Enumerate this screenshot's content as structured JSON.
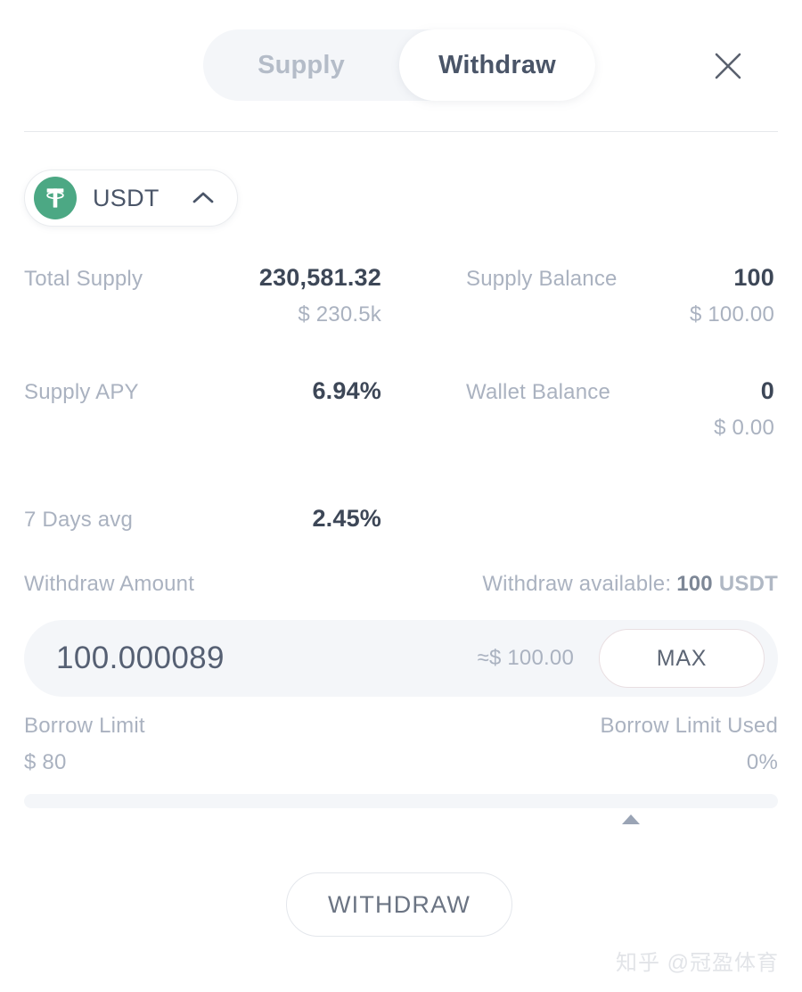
{
  "header": {
    "tabs": [
      {
        "label": "Supply",
        "active": false
      },
      {
        "label": "Withdraw",
        "active": true
      }
    ],
    "close_icon": "close-icon"
  },
  "token_selector": {
    "symbol": "USDT",
    "logo_icon": "tether-logo-icon",
    "logo_color": "#4CA884",
    "chevron_icon": "chevron-up-icon"
  },
  "stats": {
    "total_supply": {
      "label": "Total Supply",
      "value": "230,581.32",
      "sub": "$ 230.5k"
    },
    "supply_balance": {
      "label": "Supply Balance",
      "value": "100",
      "sub": "$ 100.00"
    },
    "supply_apy": {
      "label": "Supply APY",
      "value": "6.94%"
    },
    "wallet_balance": {
      "label": "Wallet Balance",
      "value": "0",
      "sub": "$ 0.00"
    },
    "seven_days_avg": {
      "label": "7 Days avg",
      "value": "2.45%"
    }
  },
  "amount": {
    "label": "Withdraw Amount",
    "available_prefix": "Withdraw available:",
    "available_amount": "100",
    "available_symbol": "USDT",
    "input_value": "100.000089",
    "input_placeholder": "0",
    "approx": "≈$ 100.00",
    "max_label": "MAX"
  },
  "borrow": {
    "limit_label": "Borrow Limit",
    "limit_value": "$ 80",
    "used_label": "Borrow Limit Used",
    "used_value": "0%",
    "used_percent": 0
  },
  "action": {
    "label": "WITHDRAW"
  },
  "watermark": {
    "text": "知乎 @冠盈体育"
  }
}
